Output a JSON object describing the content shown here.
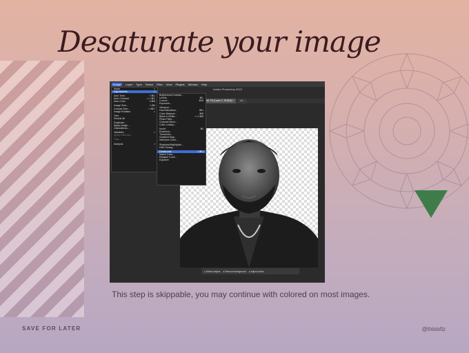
{
  "slide": {
    "title": "Desaturate your image",
    "caption": "This step is skippable, you may continue with colored on most images.",
    "footer_left": "SAVE FOR LATER",
    "footer_right": "@thisisfiz",
    "accent_color": "#3e7d4a"
  },
  "ps": {
    "menubar": [
      "Image",
      "Layer",
      "Type",
      "Select",
      "Filter",
      "View",
      "Plugins",
      "Window",
      "Help"
    ],
    "window_title": "Adobe Photoshop 2023",
    "tabs": [
      "...Ps 66.7% (...RGB/8) *",
      "davidoyalt @ 66.7% (Layer 2, RGB/8) *",
      "ad..."
    ],
    "image_menu": [
      {
        "label": "Mode",
        "shortcut": ">"
      },
      {
        "label": "Adjustments",
        "shortcut": ">",
        "highlight": true
      },
      {
        "label": "",
        "sep": true
      },
      {
        "label": "Auto Tone",
        "shortcut": "⇧⌘L"
      },
      {
        "label": "Auto Contrast",
        "shortcut": "⌥⇧⌘L"
      },
      {
        "label": "Auto Color",
        "shortcut": "⇧⌘B"
      },
      {
        "label": "",
        "sep": true
      },
      {
        "label": "Image Size...",
        "shortcut": "⌥⌘I"
      },
      {
        "label": "Canvas Size...",
        "shortcut": "⌥⌘C"
      },
      {
        "label": "Image Rotation",
        "shortcut": ">"
      },
      {
        "label": "",
        "sep": true
      },
      {
        "label": "Trim..."
      },
      {
        "label": "Reveal All"
      },
      {
        "label": "",
        "sep": true
      },
      {
        "label": "Duplicate..."
      },
      {
        "label": "Apply Image..."
      },
      {
        "label": "Calculations..."
      },
      {
        "label": "",
        "sep": true
      },
      {
        "label": "Variables",
        "shortcut": ">"
      },
      {
        "label": "Apply Data Set...",
        "dim": true
      },
      {
        "label": "",
        "sep": true
      },
      {
        "label": "Trap...",
        "dim": true
      },
      {
        "label": "",
        "sep": true
      },
      {
        "label": "Analysis",
        "shortcut": ">"
      }
    ],
    "adjust_menu": [
      {
        "label": "Brightness/Contrast..."
      },
      {
        "label": "Levels...",
        "shortcut": "⌘L"
      },
      {
        "label": "Curves...",
        "shortcut": "⌘M"
      },
      {
        "label": "Exposure..."
      },
      {
        "label": "",
        "sep": true
      },
      {
        "label": "Vibrance..."
      },
      {
        "label": "Hue/Saturation...",
        "shortcut": "⌘U"
      },
      {
        "label": "Color Balance...",
        "shortcut": "⌘B"
      },
      {
        "label": "Black & White...",
        "shortcut": "⌥⇧⌘B"
      },
      {
        "label": "Photo Filter..."
      },
      {
        "label": "Channel Mixer..."
      },
      {
        "label": "Color Lookup..."
      },
      {
        "label": "",
        "sep": true
      },
      {
        "label": "Invert",
        "shortcut": "⌘I"
      },
      {
        "label": "Posterize..."
      },
      {
        "label": "Threshold..."
      },
      {
        "label": "Gradient Map..."
      },
      {
        "label": "Selective Color..."
      },
      {
        "label": "",
        "sep": true
      },
      {
        "label": "Shadows/Highlights..."
      },
      {
        "label": "HDR Toning..."
      },
      {
        "label": "",
        "sep": true
      },
      {
        "label": "Desaturate",
        "shortcut": "⇧⌘U",
        "highlight": true
      },
      {
        "label": "Match Color..."
      },
      {
        "label": "Replace Color..."
      },
      {
        "label": "Equalize"
      }
    ],
    "taskbar": [
      "Select subject",
      "Remove background",
      "Adjust colors"
    ]
  }
}
